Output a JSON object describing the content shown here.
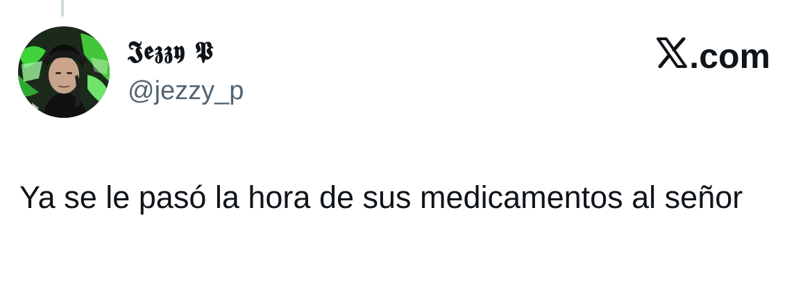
{
  "tweet": {
    "author": {
      "display_name": "𝕵𝖊𝖟𝖟𝖞 𝕻",
      "handle": "@jezzy_p",
      "avatar": "profile-photo"
    },
    "text": "Ya se le pasó la hora de sus medicamentos al señor"
  },
  "brand": {
    "icon": "x-logo-icon",
    "label": ".com"
  },
  "colors": {
    "text": "#0f1419",
    "secondary_text": "#536471",
    "thread_line": "#cfd9de",
    "avatar_accent": "#3fd43a"
  }
}
